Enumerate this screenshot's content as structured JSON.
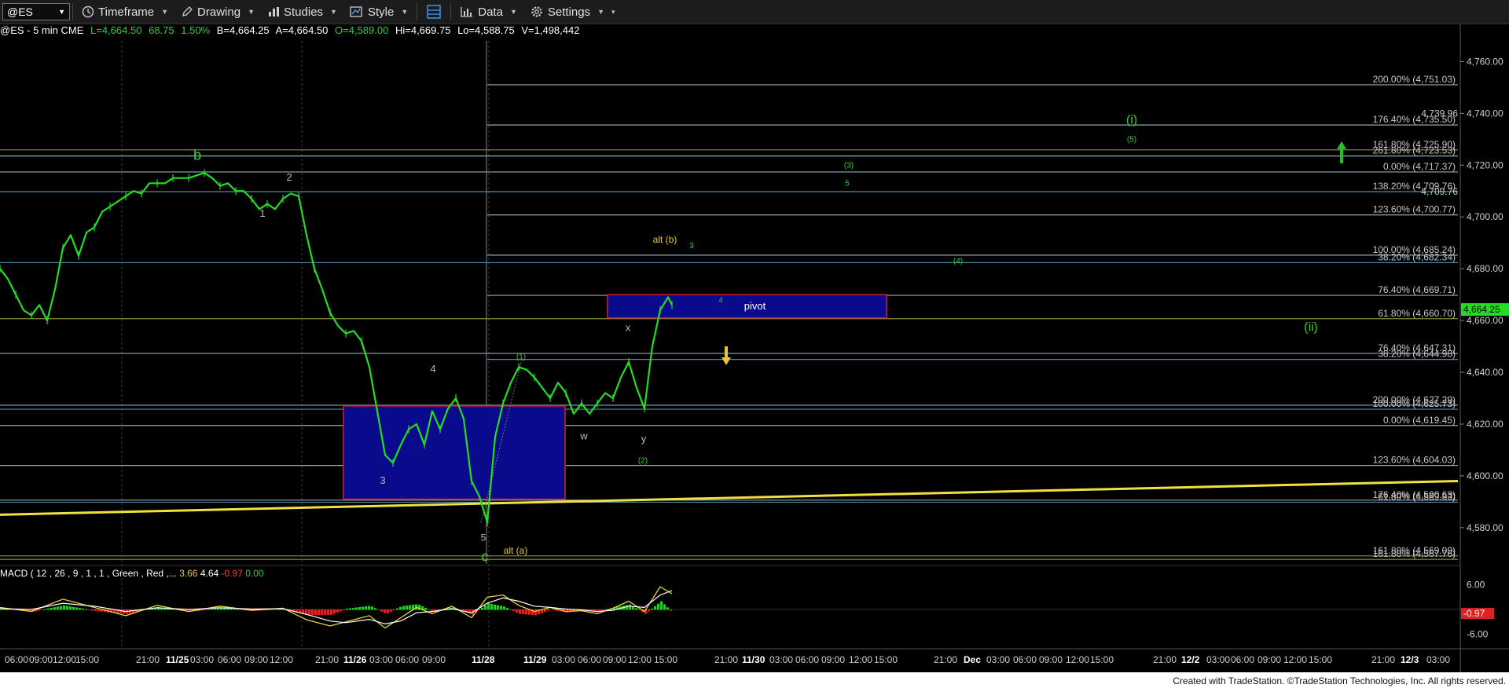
{
  "toolbar": {
    "symbol": "@ES",
    "items": [
      {
        "label": "Timeframe",
        "icon": "clock-icon"
      },
      {
        "label": "Drawing",
        "icon": "pencil-icon"
      },
      {
        "label": "Studies",
        "icon": "studies-icon"
      },
      {
        "label": "Style",
        "icon": "style-icon"
      },
      {
        "label": "",
        "icon": "layout-icon"
      },
      {
        "label": "Data",
        "icon": "data-icon"
      },
      {
        "label": "Settings",
        "icon": "gear-icon"
      }
    ]
  },
  "info": {
    "symbol_line": "@ES - 5 min  CME",
    "last": "L=4,664.50",
    "chg": "68.75",
    "pct": "1.50%",
    "bid": "B=4,664.25",
    "ask": "A=4,664.50",
    "open": "O=4,589.00",
    "high": "Hi=4,669.75",
    "low": "Lo=4,588.75",
    "vol": "V=1,498,442"
  },
  "macd": {
    "title": "MACD ( 12 , 26 , 9 , 1 , 1 , Green , Red ,...",
    "v1": "3.66",
    "v2": "4.64",
    "v3": "-0.97",
    "v4": "0.00",
    "axis": [
      "6.00",
      "-6.00"
    ],
    "badge": "-0.97"
  },
  "credit": "Created with TradeStation. ©TradeStation Technologies, Inc. All rights reserved.",
  "chart_data": {
    "type": "line",
    "title": "",
    "xlabel": "",
    "ylabel": "",
    "ylim": [
      4566,
      4768
    ],
    "y_ticks": [
      "4,760.00",
      "4,740.00",
      "4,720.00",
      "4,700.00",
      "4,680.00",
      "4,660.00",
      "4,640.00",
      "4,620.00",
      "4,600.00",
      "4,580.00"
    ],
    "last_price_badge": "4,664.25",
    "x_ticks": [
      {
        "label": "06:00",
        "b": false
      },
      {
        "label": "09:00",
        "b": false
      },
      {
        "label": "12:00",
        "b": false
      },
      {
        "label": "15:00",
        "b": false
      },
      {
        "label": "21:00",
        "b": false
      },
      {
        "label": "11/25",
        "b": true
      },
      {
        "label": "03:00",
        "b": false
      },
      {
        "label": "06:00",
        "b": false
      },
      {
        "label": "09:00",
        "b": false
      },
      {
        "label": "12:00",
        "b": false
      },
      {
        "label": "21:00",
        "b": false
      },
      {
        "label": "11/26",
        "b": true
      },
      {
        "label": "03:00",
        "b": false
      },
      {
        "label": "06:00",
        "b": false
      },
      {
        "label": "09:00",
        "b": false
      },
      {
        "label": "11/28",
        "b": true
      },
      {
        "label": "11/29",
        "b": true
      },
      {
        "label": "03:00",
        "b": false
      },
      {
        "label": "06:00",
        "b": false
      },
      {
        "label": "09:00",
        "b": false
      },
      {
        "label": "12:00",
        "b": false
      },
      {
        "label": "15:00",
        "b": false
      },
      {
        "label": "21:00",
        "b": false
      },
      {
        "label": "11/30",
        "b": true
      },
      {
        "label": "03:00",
        "b": false
      },
      {
        "label": "06:00",
        "b": false
      },
      {
        "label": "09:00",
        "b": false
      },
      {
        "label": "12:00",
        "b": false
      },
      {
        "label": "15:00",
        "b": false
      },
      {
        "label": "21:00",
        "b": false
      },
      {
        "label": "Dec",
        "b": true
      },
      {
        "label": "03:00",
        "b": false
      },
      {
        "label": "06:00",
        "b": false
      },
      {
        "label": "09:00",
        "b": false
      },
      {
        "label": "12:00",
        "b": false
      },
      {
        "label": "15:00",
        "b": false
      },
      {
        "label": "21:00",
        "b": false
      },
      {
        "label": "12/2",
        "b": true
      },
      {
        "label": "03:00",
        "b": false
      },
      {
        "label": "06:00",
        "b": false
      },
      {
        "label": "09:00",
        "b": false
      },
      {
        "label": "12:00",
        "b": false
      },
      {
        "label": "15:00",
        "b": false
      },
      {
        "label": "21:00",
        "b": false
      },
      {
        "label": "12/3",
        "b": true
      },
      {
        "label": "03:00",
        "b": false
      }
    ],
    "price_path": [
      [
        0,
        4680
      ],
      [
        10,
        4676
      ],
      [
        20,
        4670
      ],
      [
        30,
        4664
      ],
      [
        40,
        4662
      ],
      [
        50,
        4666
      ],
      [
        60,
        4660
      ],
      [
        70,
        4672
      ],
      [
        80,
        4688
      ],
      [
        90,
        4693
      ],
      [
        100,
        4685
      ],
      [
        110,
        4694
      ],
      [
        120,
        4696
      ],
      [
        130,
        4702
      ],
      [
        140,
        4704
      ],
      [
        150,
        4706
      ],
      [
        160,
        4708
      ],
      [
        170,
        4710
      ],
      [
        180,
        4709
      ],
      [
        190,
        4713
      ],
      [
        200,
        4713
      ],
      [
        210,
        4713
      ],
      [
        220,
        4715
      ],
      [
        230,
        4715
      ],
      [
        240,
        4715
      ],
      [
        250,
        4716
      ],
      [
        260,
        4717
      ],
      [
        270,
        4715
      ],
      [
        280,
        4712
      ],
      [
        290,
        4713
      ],
      [
        300,
        4710
      ],
      [
        310,
        4710
      ],
      [
        320,
        4707
      ],
      [
        330,
        4703
      ],
      [
        340,
        4705
      ],
      [
        350,
        4703
      ],
      [
        360,
        4707
      ],
      [
        370,
        4709
      ],
      [
        380,
        4708
      ],
      [
        390,
        4693
      ],
      [
        400,
        4680
      ],
      [
        410,
        4672
      ],
      [
        420,
        4663
      ],
      [
        430,
        4658
      ],
      [
        440,
        4655
      ],
      [
        450,
        4656
      ],
      [
        460,
        4652
      ],
      [
        470,
        4642
      ],
      [
        480,
        4625
      ],
      [
        490,
        4608
      ],
      [
        500,
        4605
      ],
      [
        510,
        4612
      ],
      [
        520,
        4618
      ],
      [
        530,
        4620
      ],
      [
        540,
        4612
      ],
      [
        550,
        4625
      ],
      [
        560,
        4618
      ],
      [
        570,
        4626
      ],
      [
        580,
        4630
      ],
      [
        590,
        4622
      ],
      [
        600,
        4598
      ],
      [
        610,
        4592
      ],
      [
        620,
        4582
      ],
      [
        630,
        4615
      ],
      [
        640,
        4628
      ],
      [
        650,
        4636
      ],
      [
        660,
        4642
      ],
      [
        670,
        4641
      ],
      [
        680,
        4638
      ],
      [
        690,
        4634
      ],
      [
        700,
        4630
      ],
      [
        710,
        4636
      ],
      [
        720,
        4632
      ],
      [
        730,
        4624
      ],
      [
        740,
        4628
      ],
      [
        750,
        4624
      ],
      [
        760,
        4628
      ],
      [
        770,
        4632
      ],
      [
        780,
        4630
      ],
      [
        790,
        4638
      ],
      [
        800,
        4644
      ],
      [
        810,
        4634
      ],
      [
        820,
        4626
      ],
      [
        830,
        4650
      ],
      [
        840,
        4664
      ],
      [
        850,
        4669
      ],
      [
        855,
        4666
      ]
    ],
    "price_lines": [
      {
        "label": "200.00% (4,751.03)",
        "price": 4751.03,
        "color": "#8fa8b8",
        "start": 620
      },
      {
        "label": "176.40% (4,735.50)",
        "price": 4735.5,
        "color": "#8fa8b8",
        "start": 620
      },
      {
        "label": "161.80% (4,725.90)",
        "price": 4725.9,
        "color": "#8a8a3a",
        "start": 0
      },
      {
        "label": "261.80% (4,723.53)",
        "price": 4723.53,
        "color": "#8fa8b8",
        "start": 0
      },
      {
        "label": "0.00% (4,717.37)",
        "price": 4717.37,
        "color": "#8fa8b8",
        "start": 0
      },
      {
        "label": "138.20% (4,709.76)",
        "price": 4709.76,
        "color": "#4e8ca0",
        "start": 0
      },
      {
        "label": "123.60% (4,700.77)",
        "price": 4700.77,
        "color": "#8fa8b8",
        "start": 620
      },
      {
        "label": "100.00% (4,685.24)",
        "price": 4685.24,
        "color": "#8fa8b8",
        "start": 620
      },
      {
        "label": "38.20% (4,682.34)",
        "price": 4682.34,
        "color": "#4e8ca0",
        "start": 0
      },
      {
        "label": "76.40% (4,669.71)",
        "price": 4669.71,
        "color": "#8fa8b8",
        "start": 620
      },
      {
        "label": "61.80% (4,660.70)",
        "price": 4660.7,
        "color": "#8a8a3a",
        "start": 0
      },
      {
        "label": "76.40% (4,647.31)",
        "price": 4647.31,
        "color": "#8fa8b8",
        "start": 0
      },
      {
        "label": "38.20% (4,644.98)",
        "price": 4644.98,
        "color": "#4e8ca0",
        "start": 620
      },
      {
        "label": "200.00% (4,627.29)",
        "price": 4627.29,
        "color": "#8fa8b8",
        "start": 0
      },
      {
        "label": "100.00% (4,625.73)",
        "price": 4625.73,
        "color": "#4e8ca0",
        "start": 0
      },
      {
        "label": "0.00% (4,619.45)",
        "price": 4619.45,
        "color": "#8fa8b8",
        "start": 0
      },
      {
        "label": "123.60% (4,604.03)",
        "price": 4604.03,
        "color": "#8fa8b8",
        "start": 0
      },
      {
        "label": "176.40% (4,590.63)",
        "price": 4590.63,
        "color": "#8fa8b8",
        "start": 0
      },
      {
        "label": "61.80% (4,589.83)",
        "price": 4589.83,
        "color": "#4e8ca0",
        "start": 0
      },
      {
        "label": "161.80% (4,569.09)",
        "price": 4569.09,
        "color": "#8a8a3a",
        "start": 0
      },
      {
        "label": "161.80% (4,567.76)",
        "price": 4567.76,
        "color": "#8a8a3a",
        "start": 0
      }
    ],
    "right_price_notes": [
      {
        "label": "4,739.96",
        "price": 4739.96
      },
      {
        "label": "4,709.76",
        "price": 4709.76
      }
    ],
    "boxes": [
      {
        "x0": 437,
        "x1": 719,
        "p0": 4627,
        "p1": 4591
      },
      {
        "x0": 773,
        "x1": 1128,
        "p0": 4670,
        "p1": 4661,
        "label": "pivot"
      }
    ],
    "trendline": [
      [
        0,
        4585
      ],
      [
        1855,
        4598
      ]
    ],
    "wave_labels": [
      {
        "t": "b",
        "x": 251,
        "p": 4722,
        "c": "#32cd32",
        "s": 18
      },
      {
        "t": "1",
        "x": 334,
        "p": 4700,
        "c": "#bbbbbb",
        "s": 13
      },
      {
        "t": "2",
        "x": 368,
        "p": 4714,
        "c": "#bbbbbb",
        "s": 13
      },
      {
        "t": "3",
        "x": 487,
        "p": 4597,
        "c": "#bbbbbb",
        "s": 13
      },
      {
        "t": "4",
        "x": 551,
        "p": 4640,
        "c": "#bbbbbb",
        "s": 13
      },
      {
        "t": "5",
        "x": 615,
        "p": 4575,
        "c": "#bbbbbb",
        "s": 12
      },
      {
        "t": "c",
        "x": 617,
        "p": 4567,
        "c": "#32cd32",
        "s": 18
      },
      {
        "t": "alt (a)",
        "x": 656,
        "p": 4570,
        "c": "#e6c832",
        "s": 12
      },
      {
        "t": "(1)",
        "x": 663,
        "p": 4645,
        "c": "#32cd32",
        "s": 10
      },
      {
        "t": "w",
        "x": 743,
        "p": 4614,
        "c": "#bbbbbb",
        "s": 13
      },
      {
        "t": "x",
        "x": 799,
        "p": 4656,
        "c": "#bbbbbb",
        "s": 13
      },
      {
        "t": "y",
        "x": 819,
        "p": 4613,
        "c": "#bbbbbb",
        "s": 13
      },
      {
        "t": "(2)",
        "x": 818,
        "p": 4605,
        "c": "#32cd32",
        "s": 10
      },
      {
        "t": "alt (b)",
        "x": 846,
        "p": 4690,
        "c": "#e6c832",
        "s": 12
      },
      {
        "t": "3",
        "x": 880,
        "p": 4688,
        "c": "#32cd32",
        "s": 10
      },
      {
        "t": "4",
        "x": 917,
        "p": 4667,
        "c": "#32cd32",
        "s": 9
      },
      {
        "t": "(3)",
        "x": 1080,
        "p": 4719,
        "c": "#32cd32",
        "s": 10
      },
      {
        "t": "5",
        "x": 1078,
        "p": 4712,
        "c": "#32cd32",
        "s": 10
      },
      {
        "t": "(4)",
        "x": 1219,
        "p": 4682,
        "c": "#32cd32",
        "s": 10
      },
      {
        "t": "(i)",
        "x": 1440,
        "p": 4736,
        "c": "#32cd32",
        "s": 16
      },
      {
        "t": "(5)",
        "x": 1440,
        "p": 4729,
        "c": "#32cd32",
        "s": 10
      },
      {
        "t": "(ii)",
        "x": 1668,
        "p": 4656,
        "c": "#32cd32",
        "s": 16
      }
    ],
    "arrows": [
      {
        "dir": "up",
        "x": 1707,
        "p": 4728,
        "c": "#22c422"
      },
      {
        "dir": "down",
        "x": 924,
        "p": 4650,
        "c": "#e6c832"
      }
    ],
    "macd_lines": {
      "macd": [
        [
          0,
          0.5
        ],
        [
          40,
          -0.5
        ],
        [
          80,
          2.5
        ],
        [
          120,
          0.5
        ],
        [
          160,
          -1.5
        ],
        [
          200,
          1.0
        ],
        [
          240,
          -0.5
        ],
        [
          280,
          0.8
        ],
        [
          320,
          -0.2
        ],
        [
          360,
          0.3
        ],
        [
          390,
          -2.5
        ],
        [
          420,
          -4.0
        ],
        [
          440,
          -3.0
        ],
        [
          470,
          -1.5
        ],
        [
          490,
          -4.5
        ],
        [
          510,
          -2.0
        ],
        [
          530,
          0.5
        ],
        [
          550,
          -1.0
        ],
        [
          575,
          0.8
        ],
        [
          600,
          -2.0
        ],
        [
          620,
          3.0
        ],
        [
          640,
          3.5
        ],
        [
          660,
          1.0
        ],
        [
          680,
          -0.5
        ],
        [
          700,
          0.5
        ],
        [
          720,
          -0.5
        ],
        [
          740,
          -0.3
        ],
        [
          760,
          -1.0
        ],
        [
          780,
          0.3
        ],
        [
          800,
          2.0
        ],
        [
          820,
          -0.5
        ],
        [
          840,
          5.5
        ],
        [
          855,
          3.8
        ]
      ],
      "signal": [
        [
          0,
          0.2
        ],
        [
          40,
          0.0
        ],
        [
          80,
          1.5
        ],
        [
          120,
          0.8
        ],
        [
          160,
          -0.5
        ],
        [
          200,
          0.4
        ],
        [
          240,
          0.0
        ],
        [
          280,
          0.4
        ],
        [
          320,
          0.1
        ],
        [
          360,
          0.2
        ],
        [
          390,
          -1.2
        ],
        [
          420,
          -2.8
        ],
        [
          440,
          -3.2
        ],
        [
          470,
          -2.4
        ],
        [
          490,
          -3.5
        ],
        [
          510,
          -2.8
        ],
        [
          530,
          -0.8
        ],
        [
          550,
          -0.5
        ],
        [
          575,
          0.2
        ],
        [
          600,
          -0.8
        ],
        [
          620,
          1.5
        ],
        [
          640,
          2.8
        ],
        [
          660,
          2.0
        ],
        [
          680,
          0.8
        ],
        [
          700,
          0.5
        ],
        [
          720,
          0.1
        ],
        [
          740,
          -0.1
        ],
        [
          760,
          -0.5
        ],
        [
          780,
          -0.2
        ],
        [
          800,
          0.8
        ],
        [
          820,
          0.5
        ],
        [
          840,
          3.5
        ],
        [
          855,
          4.6
        ]
      ],
      "ylim": [
        -8,
        8
      ]
    }
  }
}
